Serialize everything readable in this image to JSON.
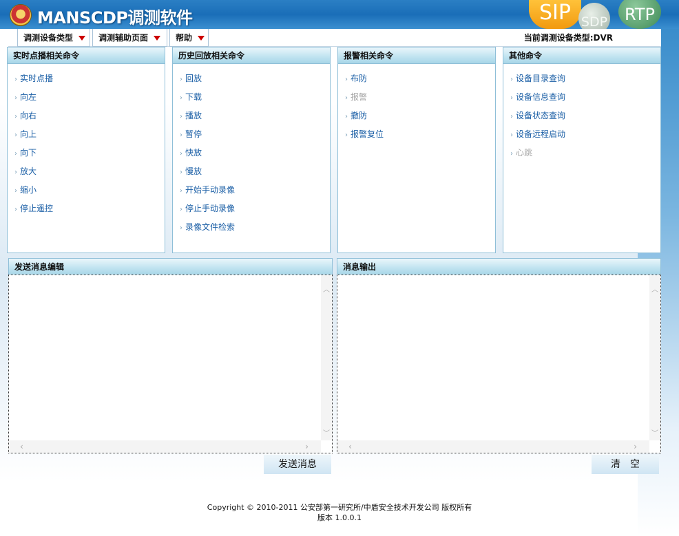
{
  "header": {
    "title": "MANSCDP调测软件",
    "badges": {
      "sip": "SIP",
      "sdp": "SDP",
      "rtp": "RTP"
    }
  },
  "menu": {
    "items": [
      {
        "label": "调测设备类型"
      },
      {
        "label": "调测辅助页面"
      },
      {
        "label": "帮助"
      }
    ],
    "current_type": "当前调测设备类型:DVR"
  },
  "panels": [
    {
      "title": "实时点播相关命令",
      "items": [
        {
          "label": "实时点播",
          "enabled": true
        },
        {
          "label": "向左",
          "enabled": true
        },
        {
          "label": "向右",
          "enabled": true
        },
        {
          "label": "向上",
          "enabled": true
        },
        {
          "label": "向下",
          "enabled": true
        },
        {
          "label": "放大",
          "enabled": true
        },
        {
          "label": "缩小",
          "enabled": true
        },
        {
          "label": "停止遥控",
          "enabled": true
        }
      ]
    },
    {
      "title": "历史回放相关命令",
      "items": [
        {
          "label": "回放",
          "enabled": true
        },
        {
          "label": "下载",
          "enabled": true
        },
        {
          "label": "播放",
          "enabled": true
        },
        {
          "label": "暂停",
          "enabled": true
        },
        {
          "label": "快放",
          "enabled": true
        },
        {
          "label": "慢放",
          "enabled": true
        },
        {
          "label": "开始手动录像",
          "enabled": true
        },
        {
          "label": "停止手动录像",
          "enabled": true
        },
        {
          "label": "录像文件检索",
          "enabled": true
        }
      ]
    },
    {
      "title": "报警相关命令",
      "items": [
        {
          "label": "布防",
          "enabled": true
        },
        {
          "label": "报警",
          "enabled": false
        },
        {
          "label": "撤防",
          "enabled": true
        },
        {
          "label": "报警复位",
          "enabled": true
        }
      ]
    },
    {
      "title": "其他命令",
      "items": [
        {
          "label": "设备目录查询",
          "enabled": true
        },
        {
          "label": "设备信息查询",
          "enabled": true
        },
        {
          "label": "设备状态查询",
          "enabled": true
        },
        {
          "label": "设备远程启动",
          "enabled": true
        },
        {
          "label": "心跳",
          "enabled": false
        }
      ]
    }
  ],
  "send": {
    "title": "发送消息编辑",
    "value": "",
    "button": "发送消息"
  },
  "output": {
    "title": "消息输出",
    "value": "",
    "button": "清　空"
  },
  "footer": {
    "copyright": "Copyright © 2010-2011 公安部第一研究所/中盾安全技术开发公司 版权所有",
    "version": "版本 1.0.0.1"
  },
  "colors": {
    "header": "#1a6eb8",
    "link": "#1b5fa6",
    "disabled": "#a6a6a6",
    "panel_border": "#8fbfd8"
  }
}
